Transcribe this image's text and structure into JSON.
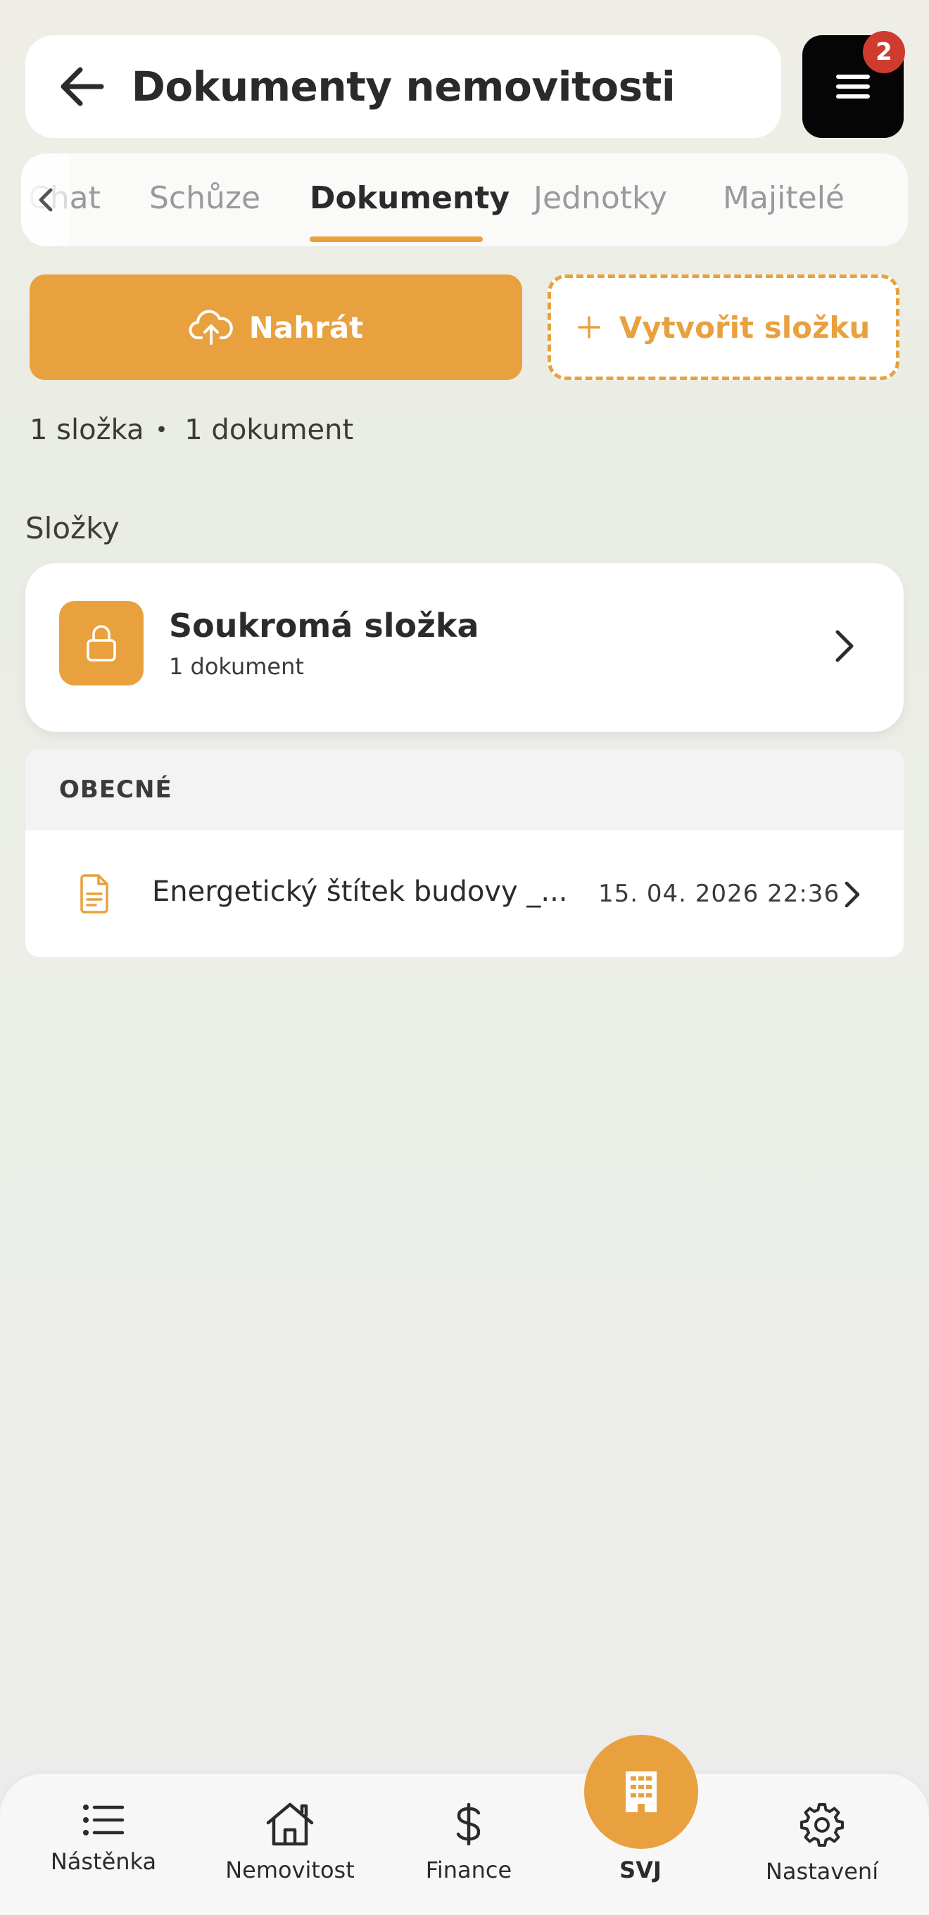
{
  "header": {
    "title": "Dokumenty nemovitosti",
    "menu_badge": "2"
  },
  "tabs": [
    {
      "label": "Chat",
      "active": false
    },
    {
      "label": "Schůze",
      "active": false
    },
    {
      "label": "Dokumenty",
      "active": true
    },
    {
      "label": "Jednotky",
      "active": false
    },
    {
      "label": "Majitelé",
      "active": false
    }
  ],
  "actions": {
    "upload_label": "Nahrát",
    "create_folder_label": "Vytvořit složku"
  },
  "counts": {
    "folders": "1 složka",
    "documents": "1 dokument"
  },
  "folders_section": {
    "label": "Složky",
    "items": [
      {
        "name": "Soukromá složka",
        "count": "1 dokument",
        "icon": "lock-icon"
      }
    ]
  },
  "general_section": {
    "label": "OBECNÉ",
    "documents": [
      {
        "name": "Energetický štítek budovy _...",
        "date": "15. 04. 2026 22:36",
        "icon": "document-icon"
      }
    ]
  },
  "bottom_nav": [
    {
      "label": "Nástěnka",
      "icon": "list-icon"
    },
    {
      "label": "Nemovitost",
      "icon": "home-icon"
    },
    {
      "label": "Finance",
      "icon": "dollar-icon"
    },
    {
      "label": "SVJ",
      "icon": "building-icon",
      "active": true
    },
    {
      "label": "Nastavení",
      "icon": "gear-icon"
    }
  ],
  "colors": {
    "accent": "#e8a13e",
    "badge": "#cf3b2e"
  }
}
